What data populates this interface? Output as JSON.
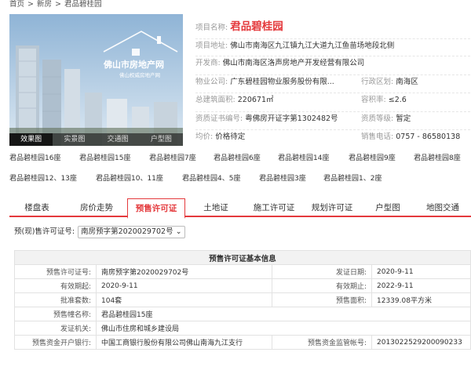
{
  "breadcrumb": {
    "items": [
      "首页",
      "新房",
      "君品碧桂园"
    ],
    "sep": ">"
  },
  "hero": {
    "watermark_line1": "佛山市房地产网",
    "watermark_line2": "佛山权威房地产网",
    "tabs": [
      "效果图",
      "实景图",
      "交通图",
      "户型图"
    ],
    "active_tab": 0
  },
  "info": {
    "name_label": "项目名称:",
    "name": "君品碧桂园",
    "address_label": "项目地址:",
    "address": "佛山市南海区九江镇九江大道九江鱼苗场地段北侧",
    "developer_label": "开发商:",
    "developer": "佛山市南海区洛声房地产开发经营有限公司",
    "property_label": "物业公司:",
    "property": "广东碧桂园物业服务股份有限...",
    "district_label": "行政区划:",
    "district": "南海区",
    "area_label": "总建筑面积:",
    "area": "220671㎡",
    "ratio_label": "容积率:",
    "ratio": "≤2.6",
    "cert_label": "资质证书编号:",
    "cert": "粤佛房开证字第1302482号",
    "grade_label": "资质等级:",
    "grade": "暂定",
    "price_label": "均价:",
    "price": "价格待定",
    "phone_label": "销售电话:",
    "phone": "0757 - 86580138"
  },
  "buildings": [
    "君品碧桂园16座",
    "君品碧桂园15座",
    "君品碧桂园7座",
    "君品碧桂园6座",
    "君品碧桂园14座",
    "君品碧桂园9座",
    "君品碧桂园8座",
    "君品碧桂园12、13座",
    "君品碧桂园10、11座",
    "君品碧桂园4、5座",
    "君品碧桂园3座",
    "君品碧桂园1、2座"
  ],
  "tabs": [
    "楼盘表",
    "房价走势",
    "预售许可证",
    "土地证",
    "施工许可证",
    "规划许可证",
    "户型图",
    "地图交通"
  ],
  "active_tab": 2,
  "permit_select": {
    "label": "预(现)售许可证号:",
    "value": "南房预字第2020029702号"
  },
  "permit_table": {
    "title": "预售许可证基本信息",
    "rows": [
      [
        "预售许可证号:",
        "南房预字第2020029702号",
        "发证日期:",
        "2020-9-11"
      ],
      [
        "有效期起:",
        "2020-9-11",
        "有效期止:",
        "2022-9-11"
      ],
      [
        "批准套数:",
        "104套",
        "预售面积:",
        "12339.08平方米"
      ],
      [
        "预售幢名称:",
        "君品碧桂园15座"
      ],
      [
        "发证机关:",
        "佛山市住房和城乡建设局"
      ],
      [
        "预售资金开户银行:",
        "中国工商银行股份有限公司佛山南海九江支行",
        "预售资金监管帐号:",
        "2013022529200090233"
      ]
    ]
  }
}
